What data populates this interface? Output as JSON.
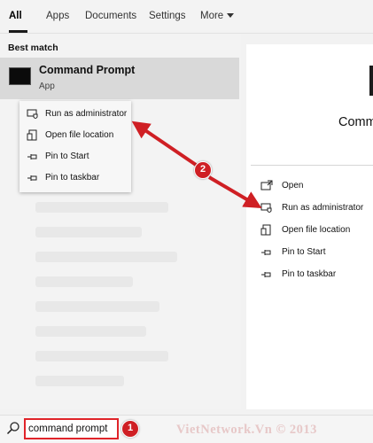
{
  "tabs": [
    {
      "label": "All",
      "active": true
    },
    {
      "label": "Apps"
    },
    {
      "label": "Documents"
    },
    {
      "label": "Settings"
    },
    {
      "label": "More"
    }
  ],
  "left": {
    "section_title": "Best match",
    "best_match": {
      "title": "Command Prompt",
      "subtitle": "App",
      "icon": "cmd-icon"
    },
    "context_menu": [
      {
        "label": "Run as administrator",
        "icon": "shield-admin-icon"
      },
      {
        "label": "Open file location",
        "icon": "file-location-icon"
      },
      {
        "label": "Pin to Start",
        "icon": "pin-icon"
      },
      {
        "label": "Pin to taskbar",
        "icon": "pin-icon"
      }
    ]
  },
  "right": {
    "title": "Comm",
    "actions": [
      {
        "label": "Open",
        "icon": "open-icon"
      },
      {
        "label": "Run as administrator",
        "icon": "shield-admin-icon"
      },
      {
        "label": "Open file location",
        "icon": "file-location-icon"
      },
      {
        "label": "Pin to Start",
        "icon": "pin-icon"
      },
      {
        "label": "Pin to taskbar",
        "icon": "pin-icon"
      }
    ]
  },
  "search": {
    "value": "command prompt",
    "icon": "search-icon"
  },
  "annotations": {
    "badge_1": "1",
    "badge_2": "2",
    "color": "#cf1f24"
  },
  "watermark": "VietNetwork.Vn © 2013"
}
